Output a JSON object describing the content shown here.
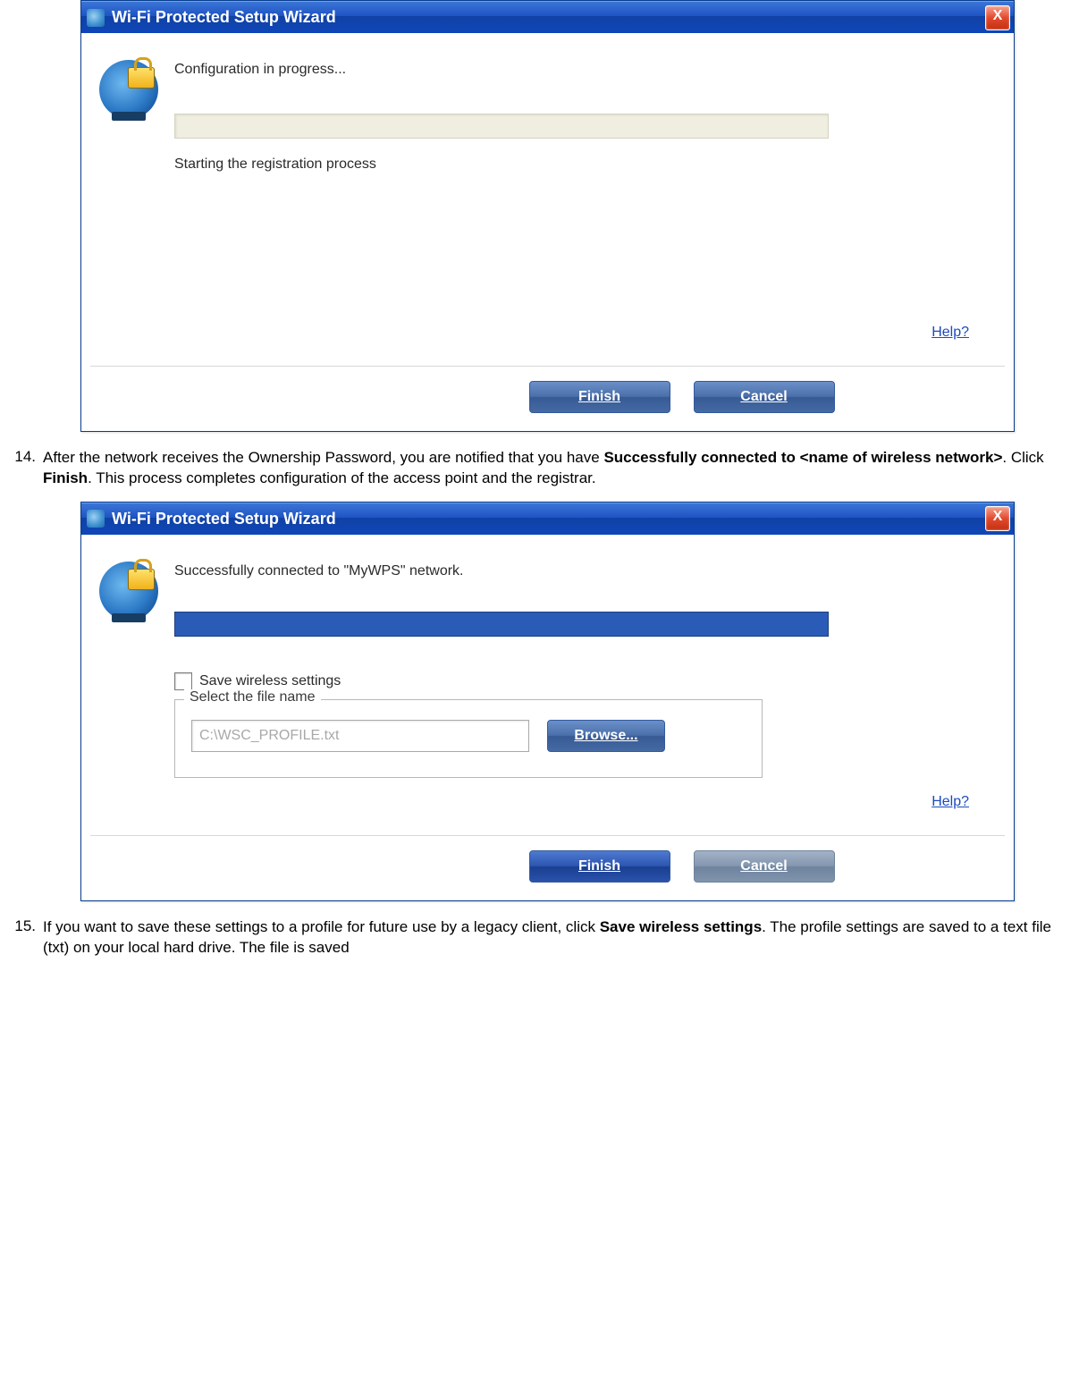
{
  "dialog1": {
    "title": "Wi-Fi Protected Setup Wizard",
    "heading": "Configuration in progress...",
    "status": "Starting the registration process",
    "help": "Help?",
    "finish": "Finish",
    "cancel": "Cancel"
  },
  "step14": {
    "num": "14.",
    "t1": "After the network receives the Ownership Password, you are notified that you have ",
    "b1": "Successfully connected to <name of wireless network>",
    "t2": ". Click ",
    "b2": "Finish",
    "t3": ". This process completes configuration of the access point and the registrar."
  },
  "dialog2": {
    "title": "Wi-Fi Protected Setup Wizard",
    "heading": "Successfully connected to \"MyWPS\" network.",
    "save_label": "Save wireless settings",
    "group_label": "Select the file name",
    "file_value": "C:\\WSC_PROFILE.txt",
    "browse": "Browse...",
    "help": "Help?",
    "finish": "Finish",
    "cancel": "Cancel"
  },
  "step15": {
    "num": "15.",
    "t1": "If you want to save these settings to a profile for future use by a legacy client, click ",
    "b1": "Save wireless settings",
    "t2": ". The profile settings are saved to a text file (txt) on your local hard drive. The file is saved"
  }
}
